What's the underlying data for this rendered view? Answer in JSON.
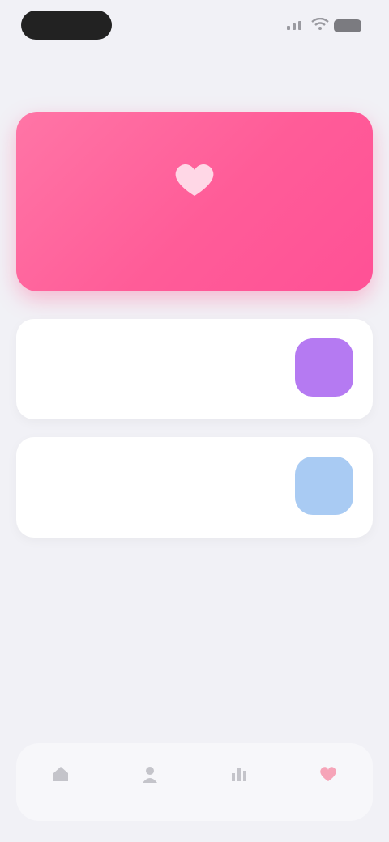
{
  "status_bar": {
    "pill_color": "#222222",
    "icons": [
      "signal-icon",
      "wifi-icon",
      "battery-icon"
    ]
  },
  "header": {
    "title": ""
  },
  "hero": {
    "icon": "heart-icon",
    "caption": "",
    "gradient": [
      "#ff75a6",
      "#ff5196"
    ]
  },
  "cards": [
    {
      "subtitle": "",
      "title": "",
      "badge_color": "#b57af2"
    },
    {
      "subtitle": "",
      "title": "",
      "badge_color": "#a9cbf3"
    }
  ],
  "tab_bar": {
    "tabs": [
      {
        "icon": "home-icon",
        "label": ""
      },
      {
        "icon": "person-icon",
        "label": ""
      },
      {
        "icon": "chart-icon",
        "label": ""
      },
      {
        "icon": "heart-icon",
        "label": "",
        "active": true
      }
    ],
    "active_color": "#f48aa6"
  }
}
